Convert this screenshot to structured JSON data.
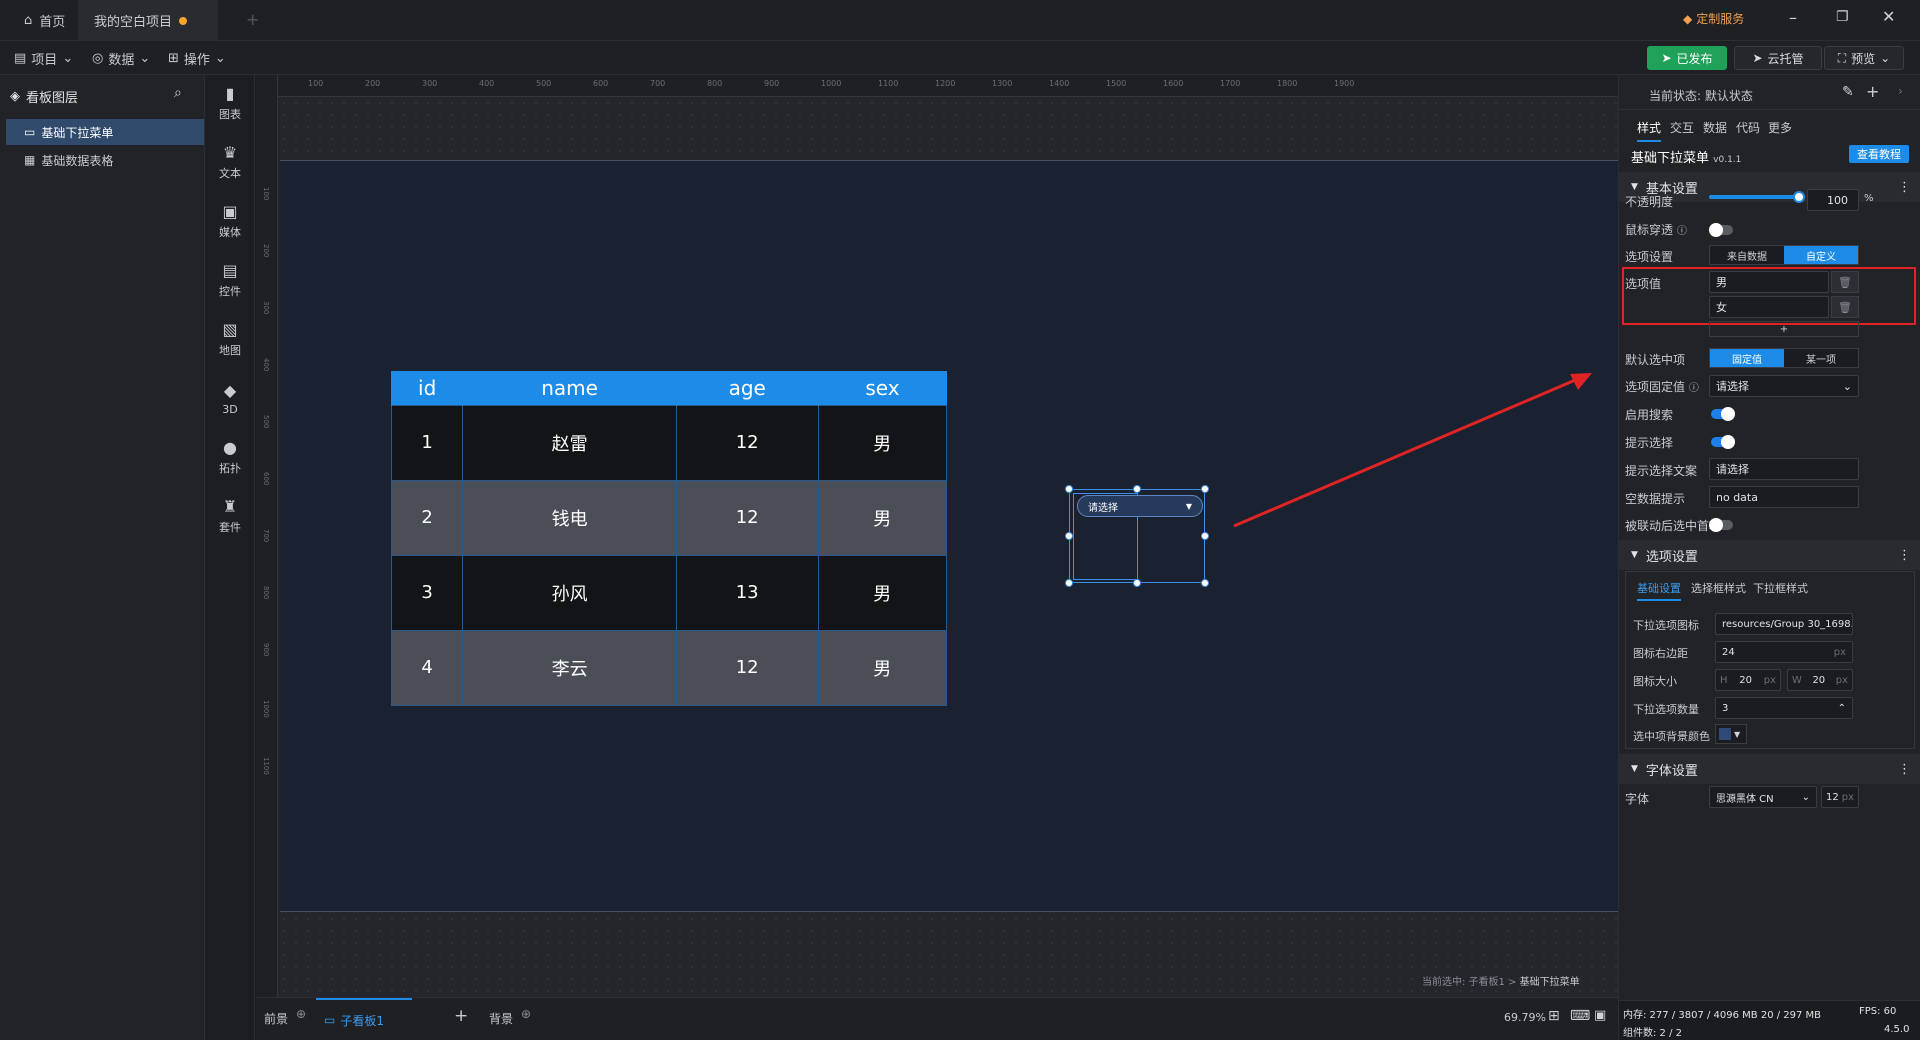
{
  "titlebar": {
    "home_tab": "首页",
    "project_tab": "我的空白项目",
    "custom_service": "定制服务"
  },
  "toolbar": {
    "menu_project": "项目",
    "menu_data": "数据",
    "menu_operate": "操作",
    "published": "已发布",
    "cloud": "云托管",
    "preview": "预览"
  },
  "left": {
    "title": "看板图层",
    "layers": [
      "基础下拉菜单",
      "基础数据表格"
    ]
  },
  "iconbar": [
    "图表",
    "文本",
    "媒体",
    "控件",
    "地图",
    "3D",
    "拓扑",
    "套件"
  ],
  "ruler": {
    "h": [
      "100",
      "200",
      "300",
      "400",
      "500",
      "600",
      "700",
      "800",
      "900",
      "1000",
      "1100",
      "1200",
      "1300",
      "1400",
      "1500",
      "1600",
      "1700",
      "1800",
      "1900"
    ],
    "v": [
      "100",
      "200",
      "300",
      "400",
      "500",
      "600",
      "700",
      "800",
      "900",
      "1000",
      "1100"
    ]
  },
  "table": {
    "headers": [
      "id",
      "name",
      "age",
      "sex"
    ],
    "rows": [
      [
        "1",
        "赵雷",
        "12",
        "男"
      ],
      [
        "2",
        "钱电",
        "12",
        "男"
      ],
      [
        "3",
        "孙风",
        "13",
        "男"
      ],
      [
        "4",
        "李云",
        "12",
        "男"
      ]
    ]
  },
  "widget": {
    "placeholder": "请选择",
    "arrow": "▼"
  },
  "canvas": {
    "status_prefix": "当前选中: 子看板1 >",
    "status_item": "基础下拉菜单"
  },
  "bottom": {
    "front": "前景",
    "board": "子看板1",
    "add": "+",
    "background": "背景",
    "zoom": "69.79%"
  },
  "right": {
    "state_label": "当前状态:",
    "state_value": "默认状态",
    "tabs": [
      "样式",
      "交互",
      "数据",
      "代码",
      "更多"
    ],
    "component_name": "基础下拉菜单",
    "version": "v0.1.1",
    "tutorial": "查看教程",
    "basic_settings": "基本设置",
    "opacity_label": "不透明度",
    "opacity_value": "100",
    "opacity_unit": "%",
    "opacity_fraction": 1.0,
    "mouse_through": "鼠标穿透",
    "option_settings_label": "选项设置",
    "source_data": "来自数据",
    "custom": "自定义",
    "option_values_label": "选项值",
    "option_values": [
      "男",
      "女"
    ],
    "add": "+",
    "default_label": "默认选中项",
    "fixed": "固定值",
    "some": "某一项",
    "fixed_value_label": "选项固定值",
    "fixed_value": "请选择",
    "search_label": "启用搜索",
    "hint_label": "提示选择",
    "hint_text_label": "提示选择文案",
    "hint_text": "请选择",
    "empty_label": "空数据提示",
    "empty_text": "no data",
    "linked_label": "被联动后选中首项",
    "options_section": "选项设置",
    "sub_tabs": [
      "基础设置",
      "选择框样式",
      "下拉框样式"
    ],
    "dd_icon_label": "下拉选项图标",
    "dd_icon_value": "resources/Group 30_1698...",
    "icon_margin_label": "图标右边距",
    "icon_margin_value": "24",
    "px": "px",
    "icon_size_label": "图标大小",
    "icon_h_label": "H",
    "icon_h": "20",
    "icon_w_label": "W",
    "icon_w": "20",
    "dd_count_label": "下拉选项数量",
    "dd_count": "3",
    "selected_bg_label": "选中项背景颜色",
    "font_section": "字体设置",
    "font_label": "字体",
    "font_value": "思源黑体 CN",
    "font_size": "12",
    "memory": "内存: 277 / 3807 / 4096 MB  20 / 297 MB",
    "fps": "FPS:  60",
    "components": "组件数: 2 / 2",
    "app_version": "4.5.0"
  },
  "colors": {
    "accent": "#1d8ce8",
    "green": "#1fa15a",
    "annotation": "#e02424"
  }
}
